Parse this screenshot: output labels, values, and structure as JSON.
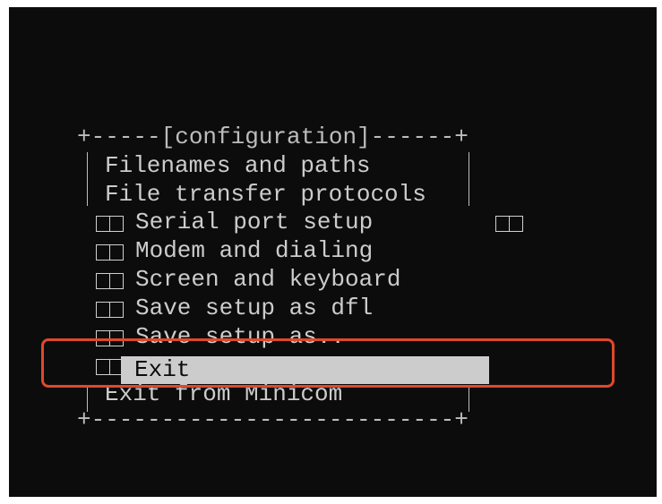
{
  "menu": {
    "top_border": "+-----[configuration]------+",
    "items": [
      {
        "label": "Filenames and paths"
      },
      {
        "label": "File transfer protocols"
      },
      {
        "label": "Serial port setup"
      },
      {
        "label": "Modem and dialing"
      },
      {
        "label": "Screen and keyboard"
      },
      {
        "label": "Save setup as dfl"
      },
      {
        "label": "Save setup as.."
      },
      {
        "label": "Exit"
      },
      {
        "label": "Exit from Minicom"
      }
    ],
    "bottom_border": "+--------------------------+"
  },
  "colors": {
    "terminal_bg": "#0c0c0c",
    "text": "#cccccc",
    "selection_bg": "#cccccc",
    "annotation": "#e0482b"
  }
}
